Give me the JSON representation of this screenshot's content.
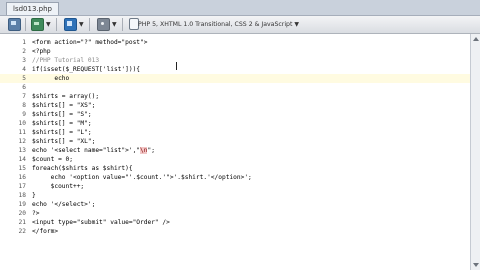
{
  "tab": {
    "label": "lsd013.php"
  },
  "toolbar": {
    "doctype_label": "PHP 5, XHTML 1.0 Transitional, CSS 2 & JavaScript",
    "icons": [
      "monitor-icon",
      "green-icon",
      "blue-icon",
      "tools-icon",
      "page-icon"
    ]
  },
  "editor": {
    "lines": [
      {
        "n": "1",
        "text": "<form action=\"?\" method=\"post\">"
      },
      {
        "n": "2",
        "text": "<?php"
      },
      {
        "n": "3",
        "text": "//PHP Tutorial 013",
        "comment": true
      },
      {
        "n": "4",
        "text": "if(isset($_REQUEST['list'])){"
      },
      {
        "n": "5",
        "text": "      echo",
        "current": true
      },
      {
        "n": "6",
        "text": ""
      },
      {
        "n": "7",
        "text": "$shirts = array();"
      },
      {
        "n": "8",
        "text": "$shirts[] = \"XS\";"
      },
      {
        "n": "9",
        "text": "$shirts[] = \"S\";"
      },
      {
        "n": "10",
        "text": "$shirts[] = \"M\";"
      },
      {
        "n": "11",
        "text": "$shirts[] = \"L\";"
      },
      {
        "n": "12",
        "text": "$shirts[] = \"XL\";"
      },
      {
        "n": "13",
        "text": "echo '<select name=\"list\">',\"\\n\";",
        "highlight": "\\n"
      },
      {
        "n": "14",
        "text": "$count = 0;"
      },
      {
        "n": "15",
        "text": "foreach($shirts as $shirt){"
      },
      {
        "n": "16",
        "text": "     echo '<option value=\"'.$count.'\">'.$shirt.'</option>';"
      },
      {
        "n": "17",
        "text": "     $count++;"
      },
      {
        "n": "18",
        "text": "}"
      },
      {
        "n": "19",
        "text": "echo '</select>';"
      },
      {
        "n": "20",
        "text": "?>"
      },
      {
        "n": "21",
        "text": "<input type=\"submit\" value=\"Order\" />"
      },
      {
        "n": "22",
        "text": "</form>"
      }
    ]
  }
}
